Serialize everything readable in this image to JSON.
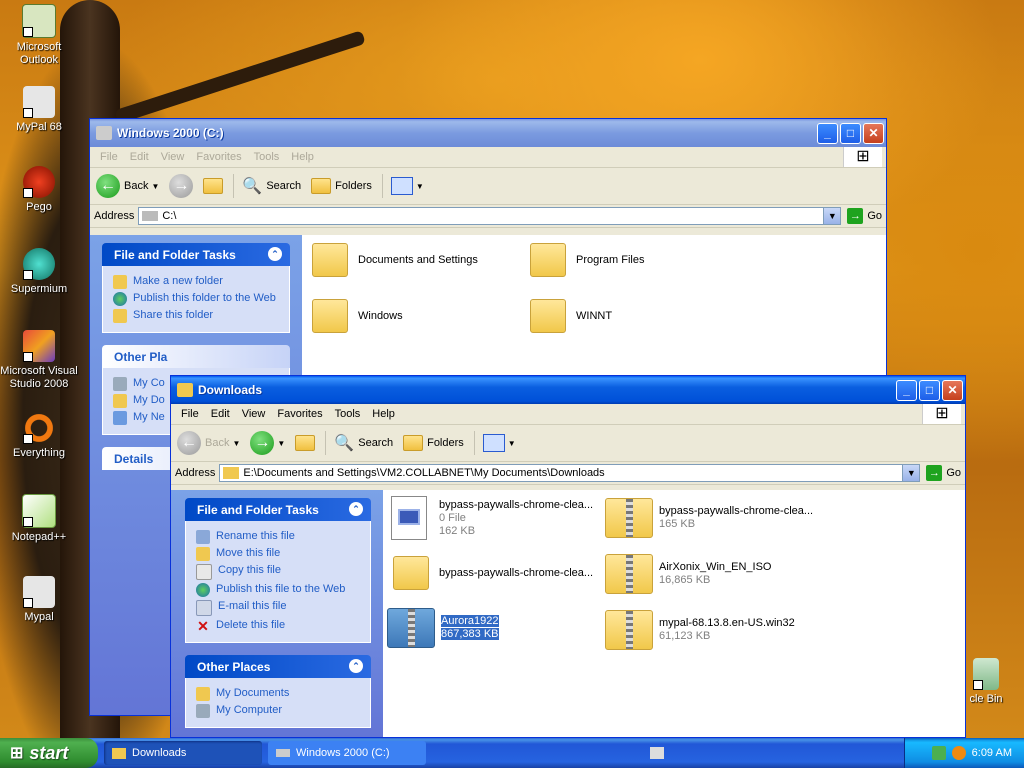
{
  "desktop": {
    "icons": [
      {
        "label": "Microsoft Outlook",
        "icon": "outlook-icon"
      },
      {
        "label": "MyPal 68",
        "icon": "mypal-icon"
      },
      {
        "label": "Pego",
        "icon": "pego-icon"
      },
      {
        "label": "Supermium",
        "icon": "supermium-icon"
      },
      {
        "label": "Microsoft Visual Studio 2008",
        "icon": "visual-studio-icon"
      },
      {
        "label": "Everything",
        "icon": "everything-icon"
      },
      {
        "label": "Notepad++",
        "icon": "notepadpp-icon"
      },
      {
        "label": "Mypal",
        "icon": "mypal-icon"
      },
      {
        "label": "cle Bin",
        "icon": "recycle-bin-icon"
      }
    ]
  },
  "win_c": {
    "title": "Windows 2000 (C:)",
    "menu": [
      "File",
      "Edit",
      "View",
      "Favorites",
      "Tools",
      "Help"
    ],
    "toolbar": {
      "back": "Back",
      "search": "Search",
      "folders": "Folders"
    },
    "address_label": "Address",
    "address": "C:\\",
    "go": "Go",
    "tasks_title": "File and Folder Tasks",
    "tasks": [
      "Make a new folder",
      "Publish this folder to the Web",
      "Share this folder"
    ],
    "other_places_title": "Other Pla",
    "other_places": [
      "My Co",
      "My Do",
      "My Ne"
    ],
    "details_title": "Details",
    "items": [
      "Documents and Settings",
      "Program Files",
      "Windows",
      "WINNT"
    ]
  },
  "win_dl": {
    "title": "Downloads",
    "menu": [
      "File",
      "Edit",
      "View",
      "Favorites",
      "Tools",
      "Help"
    ],
    "toolbar": {
      "back": "Back",
      "search": "Search",
      "folders": "Folders"
    },
    "address_label": "Address",
    "address": "E:\\Documents and Settings\\VM2.COLLABNET\\My Documents\\Downloads",
    "go": "Go",
    "tasks_title": "File and Folder Tasks",
    "tasks": [
      "Rename this file",
      "Move this file",
      "Copy this file",
      "Publish this file to the Web",
      "E-mail this file",
      "Delete this file"
    ],
    "other_places_title": "Other Places",
    "other_places": [
      "My Documents",
      "My Computer"
    ],
    "files": [
      {
        "name": "bypass-paywalls-chrome-clea...",
        "line2": "0 File",
        "line3": "162 KB"
      },
      {
        "name": "bypass-paywalls-chrome-clea...",
        "line2": "165 KB"
      },
      {
        "name": "bypass-paywalls-chrome-clea..."
      },
      {
        "name": "AirXonix_Win_EN_ISO",
        "line2": "16,865 KB"
      },
      {
        "name": "Aurora1922",
        "line2": "867,383 KB"
      },
      {
        "name": "mypal-68.13.8.en-US.win32",
        "line2": "61,123 KB"
      }
    ]
  },
  "taskbar": {
    "start": "start",
    "items": [
      "Downloads",
      "Windows 2000 (C:)"
    ],
    "clock": "6:09 AM"
  },
  "colors": {
    "xp_blue": "#0a5fe0",
    "task_link": "#215dc6",
    "selection": "#316ac5"
  }
}
